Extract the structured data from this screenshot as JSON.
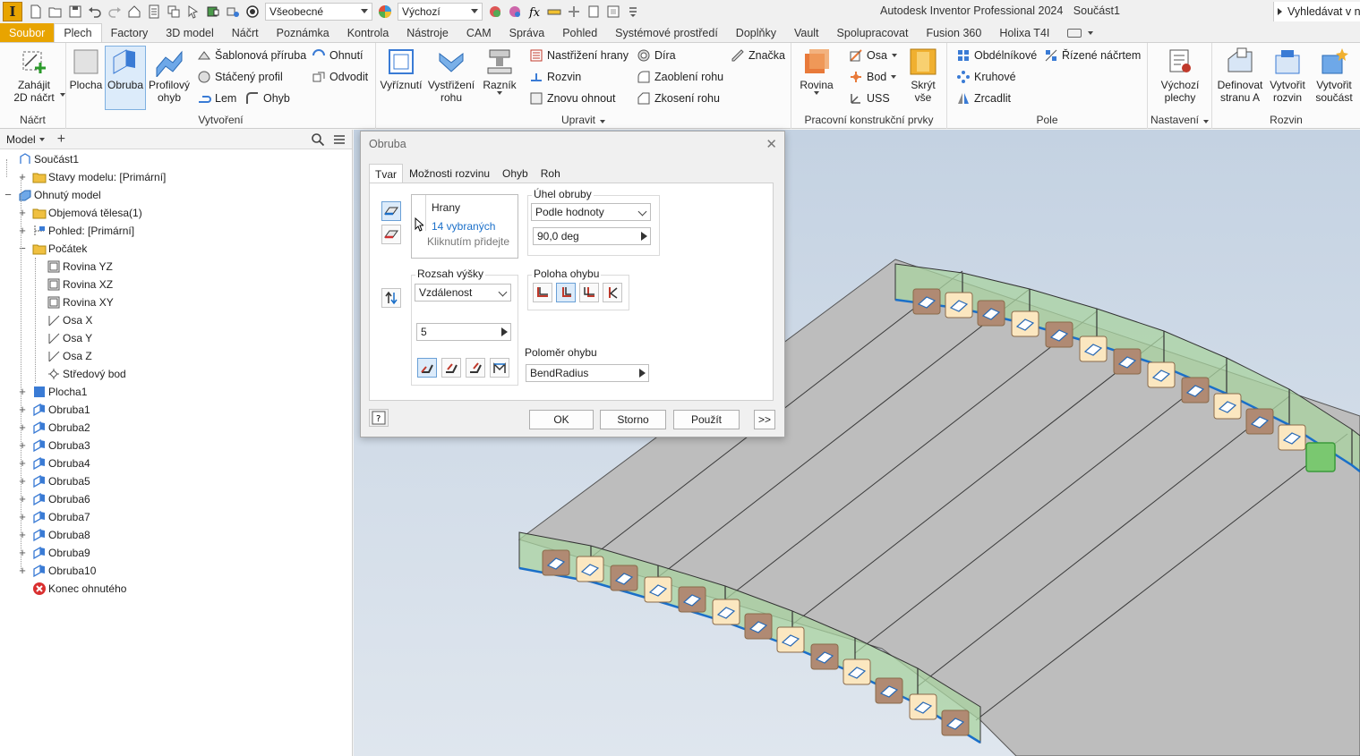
{
  "titlebar": {
    "logo": "I",
    "combo_style": "Všeobecné",
    "combo_view": "Výchozí",
    "app_title": "Autodesk Inventor Professional 2024",
    "doc_title": "Součást1",
    "search": "Vyhledávat v n"
  },
  "ribbon_tabs": [
    "Soubor",
    "Plech",
    "Factory",
    "3D model",
    "Náčrt",
    "Poznámka",
    "Kontrola",
    "Nástroje",
    "CAM",
    "Správa",
    "Pohled",
    "Systémové prostředí",
    "Doplňky",
    "Vault",
    "Spolupracovat",
    "Fusion 360",
    "Holixa T4I"
  ],
  "ribbon": {
    "sketch": {
      "title": "Náčrt",
      "start": "Zahájit\n2D náčrt"
    },
    "create": {
      "title": "Vytvoření",
      "face": "Plocha",
      "flange": "Obruba",
      "contour_flange": "Profilový\nohyb",
      "small": [
        "Šablonová příruba",
        "Stáčený profil",
        "Lem",
        "Ohyb",
        "Ohnutí",
        "Odvodit"
      ]
    },
    "modify": {
      "title": "Upravit",
      "cut": "Vyříznutí",
      "corner_seam": "Vystřižení\nrohu",
      "punch": "Razník",
      "small": [
        "Nastřižení hrany",
        "Rozvin",
        "Znovu ohnout",
        "Díra",
        "Zaoblení rohu",
        "Zkosení rohu",
        "Značka"
      ]
    },
    "work": {
      "title": "Pracovní konstrukční prvky",
      "plane": "Rovina",
      "axis": "Osa",
      "point": "Bod",
      "ucs": "USS",
      "hide": "Skrýt vše"
    },
    "pattern": {
      "title": "Pole",
      "rect": "Obdélníkové",
      "circ": "Kruhové",
      "mirror": "Zrcadlit",
      "sketch_driven": "Řízené náčrtem"
    },
    "setup": {
      "title": "Nastavení",
      "defaults": "Výchozí\nplechy"
    },
    "flat": {
      "title": "Rozvin",
      "define_a": "Definovat\nstranu A",
      "create_flat": "Vytvořit\nrozvin",
      "create_part": "Vytvořit\nsoučást"
    }
  },
  "browser": {
    "tab": "Model",
    "items": [
      {
        "label": "Součást1",
        "icon": "part-icon"
      },
      {
        "label": "Stavy modelu: [Primární]",
        "icon": "folder-icon"
      },
      {
        "label": "Ohnutý model",
        "icon": "sheet-metal-icon"
      },
      {
        "label": "Objemová tělesa(1)",
        "icon": "folder-icon"
      },
      {
        "label": "Pohled: [Primární]",
        "icon": "view-icon"
      },
      {
        "label": "Počátek",
        "icon": "folder-icon"
      },
      {
        "label": "Rovina YZ",
        "icon": "plane-icon"
      },
      {
        "label": "Rovina XZ",
        "icon": "plane-icon"
      },
      {
        "label": "Rovina XY",
        "icon": "plane-icon"
      },
      {
        "label": "Osa X",
        "icon": "axis-icon"
      },
      {
        "label": "Osa Y",
        "icon": "axis-icon"
      },
      {
        "label": "Osa Z",
        "icon": "axis-icon"
      },
      {
        "label": "Středový bod",
        "icon": "point-icon"
      },
      {
        "label": "Plocha1",
        "icon": "face-icon"
      },
      {
        "label": "Obruba1",
        "icon": "flange-icon"
      },
      {
        "label": "Obruba2",
        "icon": "flange-icon"
      },
      {
        "label": "Obruba3",
        "icon": "flange-icon"
      },
      {
        "label": "Obruba4",
        "icon": "flange-icon"
      },
      {
        "label": "Obruba5",
        "icon": "flange-icon"
      },
      {
        "label": "Obruba6",
        "icon": "flange-icon"
      },
      {
        "label": "Obruba7",
        "icon": "flange-icon"
      },
      {
        "label": "Obruba8",
        "icon": "flange-icon"
      },
      {
        "label": "Obruba9",
        "icon": "flange-icon"
      },
      {
        "label": "Obruba10",
        "icon": "flange-icon"
      },
      {
        "label": "Konec ohnutého",
        "icon": "end-of-part-icon"
      }
    ]
  },
  "dialog": {
    "title": "Obruba",
    "tabs": [
      "Tvar",
      "Možnosti rozvinu",
      "Ohyb",
      "Roh"
    ],
    "edges_label": "Hrany",
    "edges_selected": "14 vybraných",
    "edges_hint": "Kliknutím přidejte",
    "angle_group": "Úhel obruby",
    "angle_mode": "Podle hodnoty",
    "angle_value": "90,0 deg",
    "height_group": "Rozsah výšky",
    "height_mode": "Vzdálenost",
    "height_value": "5",
    "bend_pos_group": "Poloha ohybu",
    "bend_radius_label": "Poloměr ohybu",
    "bend_radius_value": "BendRadius",
    "ok": "OK",
    "cancel": "Storno",
    "apply": "Použít",
    "more": ">>"
  },
  "colors": {
    "file_tab": "#e8a400",
    "selection_blue": "#1a6fc9",
    "flange_green": "#a9d3a0",
    "marker_tan": "#b08a73",
    "marker_cream": "#fbe7c0"
  }
}
